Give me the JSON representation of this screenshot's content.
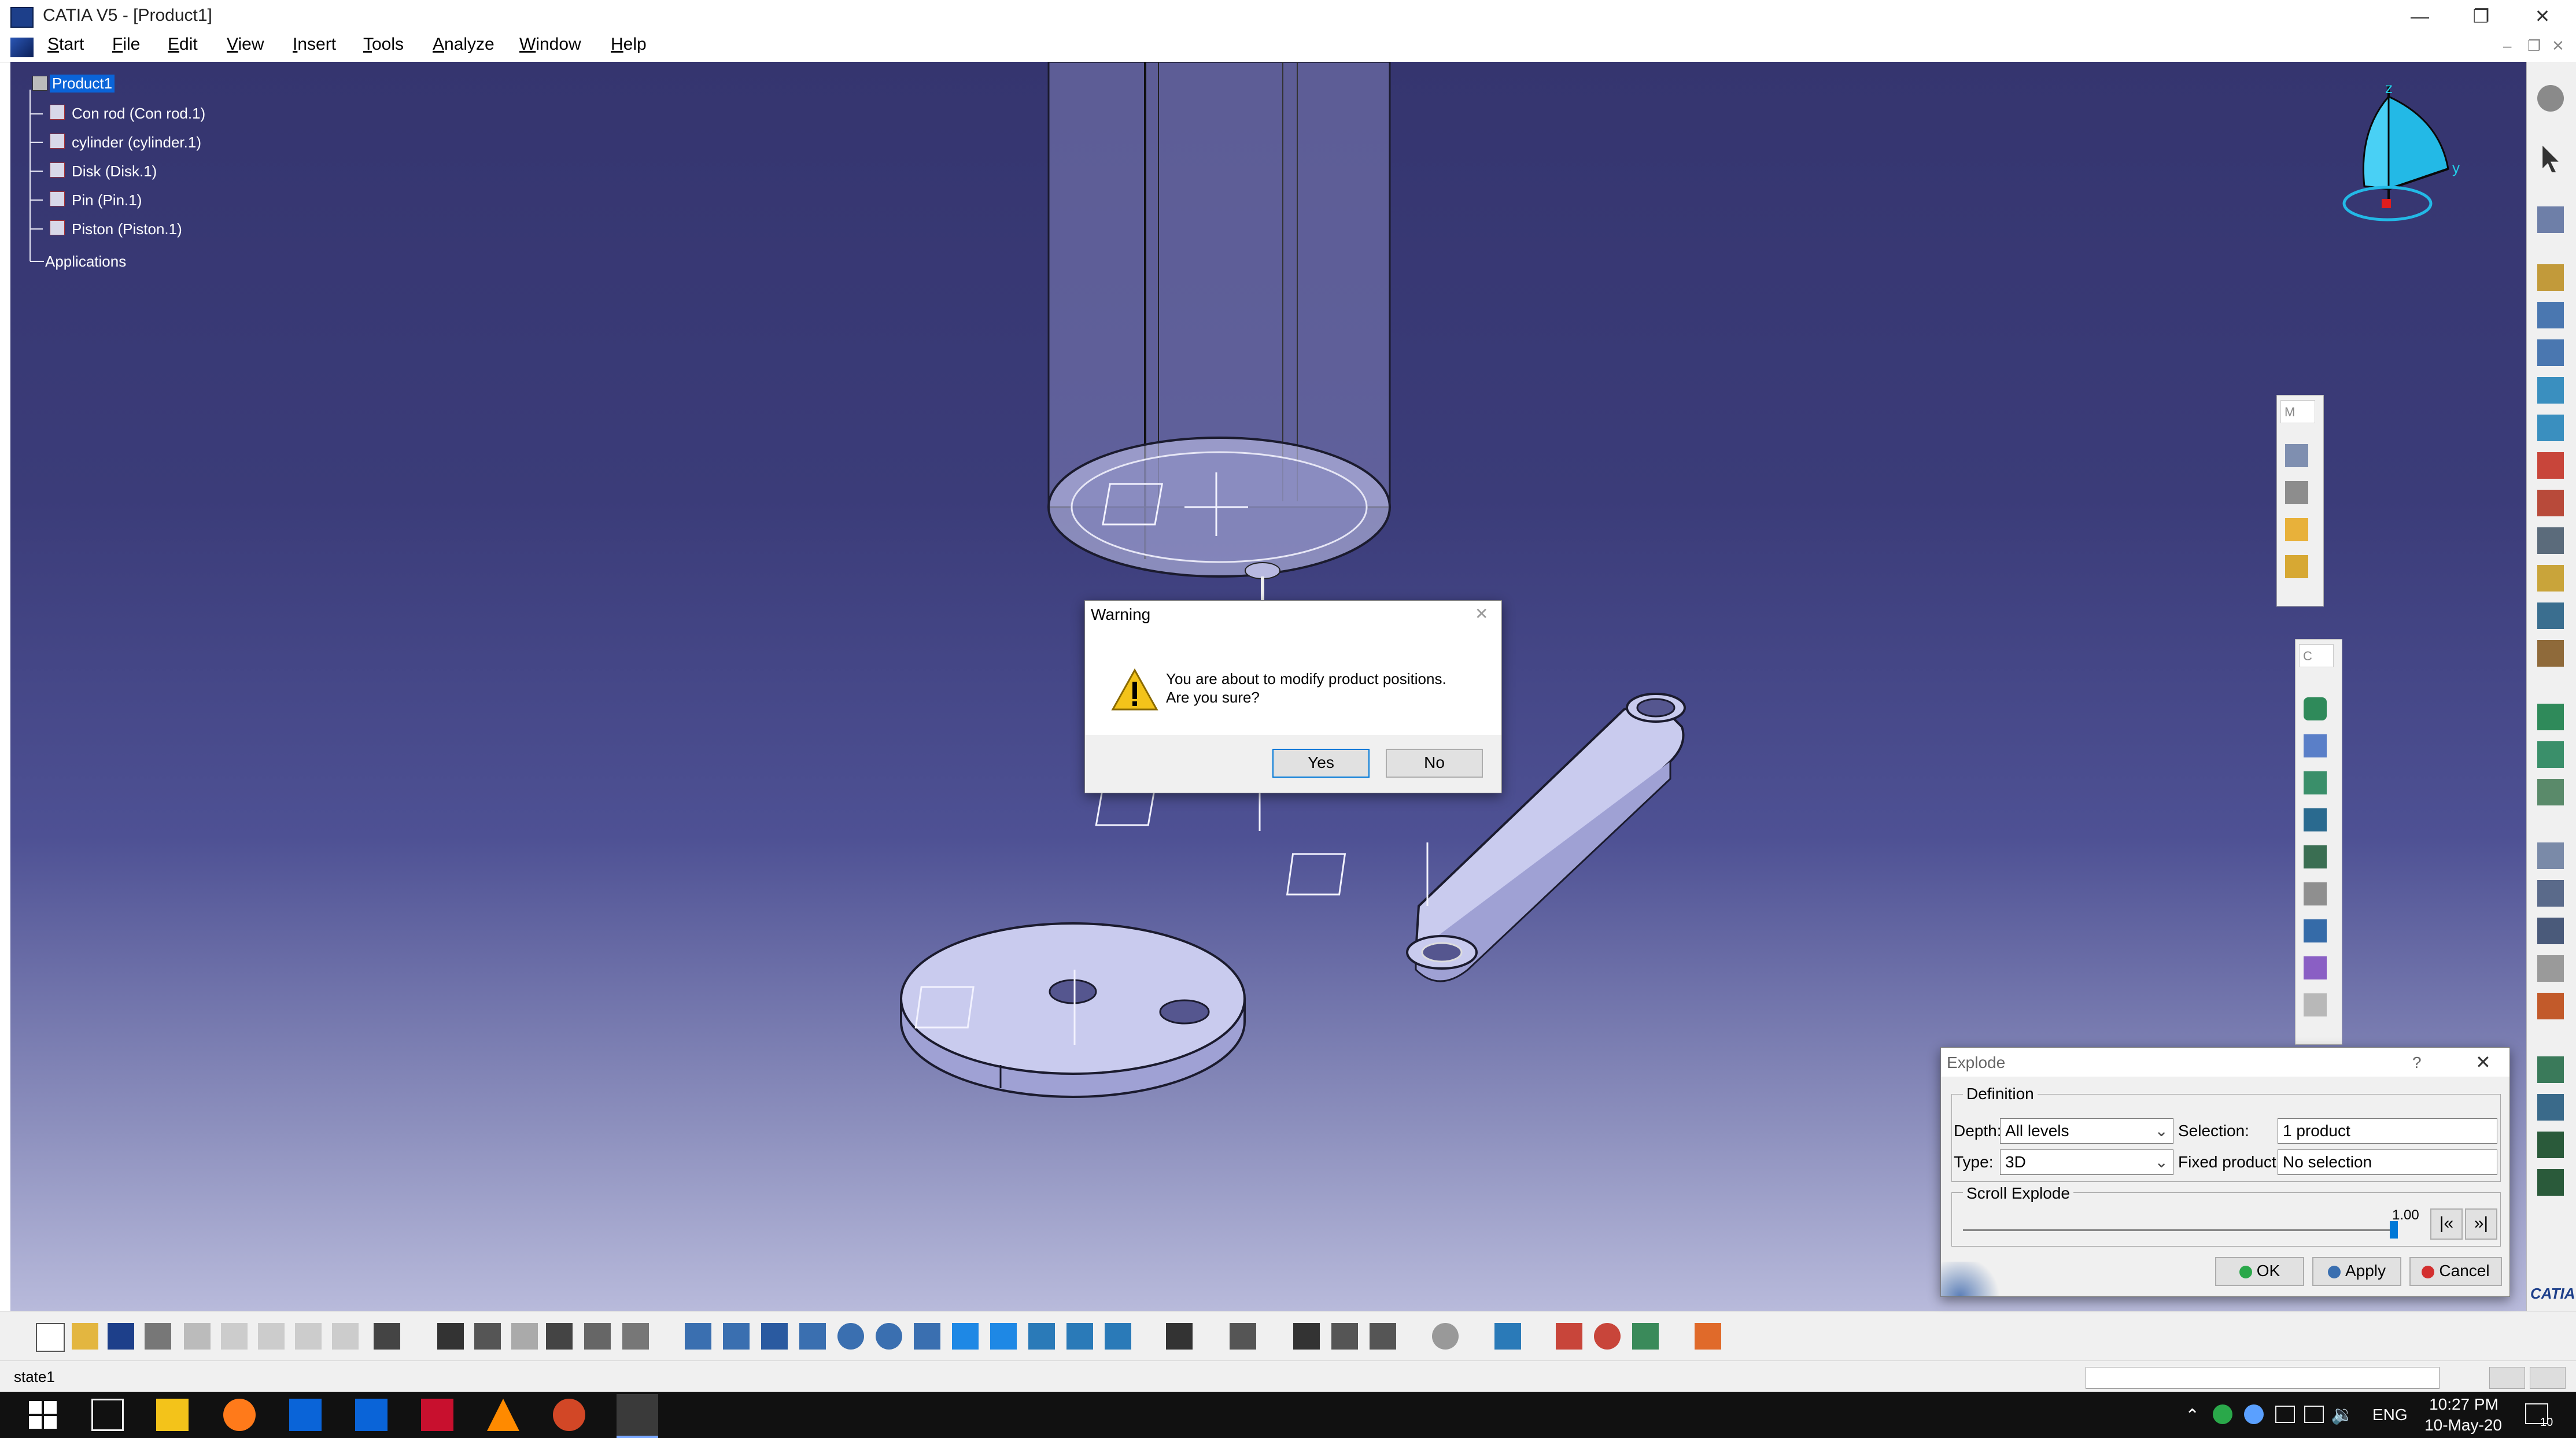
{
  "window": {
    "title": "CATIA V5 - [Product1]",
    "controls": {
      "minimize": "—",
      "restore": "❐",
      "close": "✕"
    }
  },
  "menu": {
    "items": [
      {
        "label": "Start",
        "ul": "S",
        "rest": "tart"
      },
      {
        "label": "File",
        "ul": "F",
        "rest": "ile"
      },
      {
        "label": "Edit",
        "ul": "E",
        "rest": "dit"
      },
      {
        "label": "View",
        "ul": "V",
        "rest": "iew"
      },
      {
        "label": "Insert",
        "ul": "I",
        "rest": "nsert"
      },
      {
        "label": "Tools",
        "ul": "T",
        "rest": "ools"
      },
      {
        "label": "Analyze",
        "ul": "A",
        "rest": "nalyze"
      },
      {
        "label": "Window",
        "ul": "W",
        "rest": "indow"
      },
      {
        "label": "Help",
        "ul": "H",
        "rest": "elp"
      }
    ]
  },
  "tree": {
    "root": "Product1",
    "children": [
      "Con rod (Con rod.1)",
      "cylinder (cylinder.1)",
      "Disk (Disk.1)",
      "Pin (Pin.1)",
      "Piston (Piston.1)"
    ],
    "applications": "Applications"
  },
  "compass": {
    "z": "z",
    "y": "y"
  },
  "float_toolbars": {
    "m_label": "M",
    "c_label": "C"
  },
  "warning": {
    "title": "Warning",
    "message_line1": "You are about to modify product positions.",
    "message_line2": "Are you sure?",
    "yes": "Yes",
    "no": "No"
  },
  "explode": {
    "title": "Explode",
    "help": "?",
    "definition": "Definition",
    "depth_label": "Depth:",
    "depth_value": "All levels",
    "selection_label": "Selection:",
    "selection_value": "1 product",
    "type_label": "Type:",
    "type_value": "3D",
    "fixed_label": "Fixed product:",
    "fixed_value": "No selection",
    "scroll_group": "Scroll Explode",
    "scroll_value": "1.00",
    "scroll_fraction": 1.0,
    "ok": "OK",
    "apply": "Apply",
    "cancel": "Cancel"
  },
  "status": {
    "text": "state1"
  },
  "brand": "CATIA",
  "taskbar": {
    "lang": "ENG",
    "time": "10:27 PM",
    "date": "10-May-20",
    "notif_count": "10"
  },
  "colors": {
    "viewport_top": "#35356f",
    "part_fill": "#c9cbee",
    "accent_selection": "#0a64d8",
    "warning_yellow": "#f3c31a"
  }
}
